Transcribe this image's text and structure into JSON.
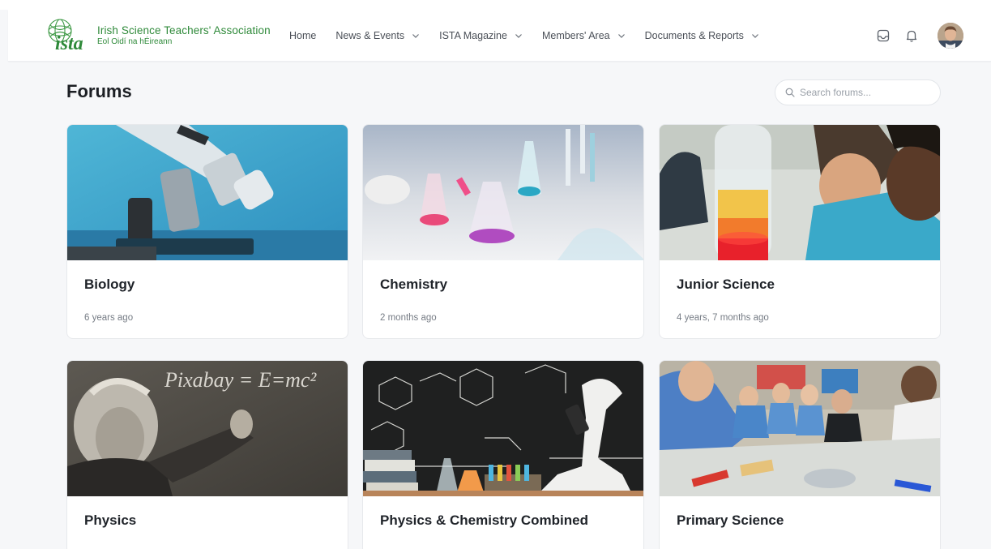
{
  "header": {
    "logo_title": "Irish Science Teachers' Association",
    "logo_subtitle": "Eol Oidí na hÉireann",
    "logo_mark": "ista",
    "nav": [
      {
        "label": "Home",
        "has_dropdown": false
      },
      {
        "label": "News & Events",
        "has_dropdown": true
      },
      {
        "label": "ISTA Magazine",
        "has_dropdown": true
      },
      {
        "label": "Members' Area",
        "has_dropdown": true
      },
      {
        "label": "Documents & Reports",
        "has_dropdown": true
      }
    ],
    "icons": [
      "inbox-icon",
      "bell-icon",
      "user-avatar"
    ]
  },
  "page": {
    "title": "Forums",
    "search_placeholder": "Search forums..."
  },
  "forums": [
    {
      "title": "Biology",
      "meta": "6 years ago",
      "image": "microscope"
    },
    {
      "title": "Chemistry",
      "meta": "2 months ago",
      "image": "lab-flasks"
    },
    {
      "title": "Junior Science",
      "meta": "4 years, 7 months ago",
      "image": "students-bottle"
    },
    {
      "title": "Physics",
      "meta": "",
      "image": "einstein-blackboard"
    },
    {
      "title": "Physics & Chemistry Combined",
      "meta": "",
      "image": "chemistry-blackboard-microscope"
    },
    {
      "title": "Primary Science",
      "meta": "",
      "image": "classroom"
    }
  ],
  "image_text": {
    "physics_board": "Pixabay = E=mc²"
  },
  "colors": {
    "brand_green": "#2f8a3a",
    "background": "#f6f7f9",
    "card_border": "#e7e9ec"
  }
}
